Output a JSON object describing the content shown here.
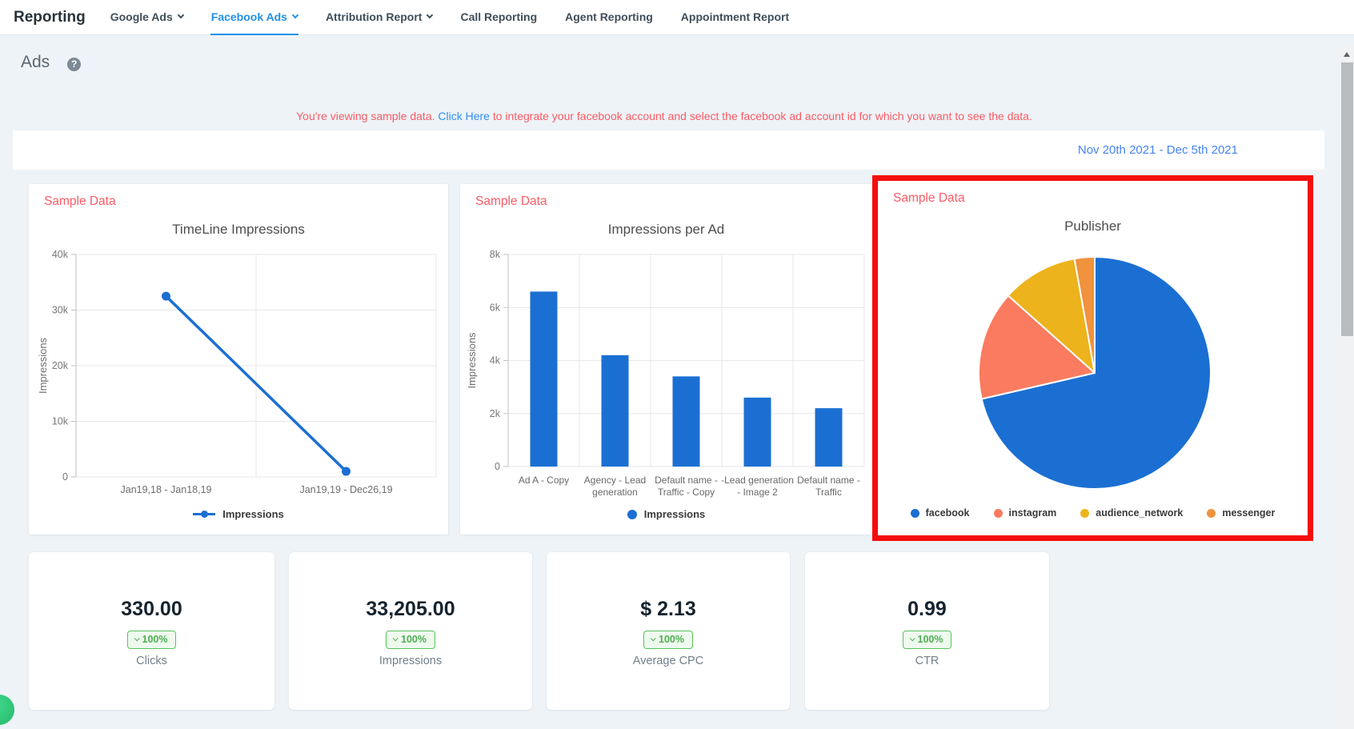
{
  "nav": {
    "brand": "Reporting",
    "items": [
      {
        "label": "Google Ads",
        "has_dropdown": true,
        "active": false
      },
      {
        "label": "Facebook Ads",
        "has_dropdown": true,
        "active": true
      },
      {
        "label": "Attribution Report",
        "has_dropdown": true,
        "active": false
      },
      {
        "label": "Call Reporting",
        "has_dropdown": false,
        "active": false
      },
      {
        "label": "Agent Reporting",
        "has_dropdown": false,
        "active": false
      },
      {
        "label": "Appointment Report",
        "has_dropdown": false,
        "active": false
      }
    ]
  },
  "page": {
    "title": "Ads",
    "help_icon": "question-mark-circle"
  },
  "banner": {
    "prefix": "You're viewing sample data.",
    "link": "Click Here",
    "suffix": "to integrate your facebook account and select the facebook ad account id for which you want to see the data."
  },
  "date_range": "Nov 20th 2021 - Dec 5th 2021",
  "sample_data_label": "Sample Data",
  "colors": {
    "accent_blue": "#2191ea",
    "alert_red": "#fb5b64",
    "link_blue": "#2f8ef4",
    "date_blue": "#4584f0",
    "chart_blue": "#1b6fd2",
    "badge_green": "#4cae4f",
    "annotation_red": "#f60d0d"
  },
  "chart_data": [
    {
      "type": "line",
      "title": "TimeLine Impressions",
      "ylabel": "Impressions",
      "x": [
        "Jan19,18 - Jan18,19",
        "Jan19,19 - Dec26,19"
      ],
      "series": [
        {
          "name": "Impressions",
          "values": [
            32500,
            1000
          ]
        }
      ],
      "ylim": [
        0,
        40000
      ],
      "yticks": [
        "0",
        "10k",
        "20k",
        "30k",
        "40k"
      ],
      "grid": true,
      "legend_position": "bottom",
      "color": "#1b6fd2"
    },
    {
      "type": "bar",
      "title": "Impressions per Ad",
      "ylabel": "Impressions",
      "categories": [
        "Ad A - Copy",
        "Agency - Lead generation",
        "Default name - Traffic - Copy",
        "-Lead generation - Image 2",
        "Default name - Traffic"
      ],
      "categories_lines": [
        [
          "Ad A - Copy"
        ],
        [
          "Agency - Lead",
          "generation"
        ],
        [
          "Default name -",
          "Traffic - Copy"
        ],
        [
          "-Lead generation",
          "- Image 2"
        ],
        [
          "Default name -",
          "Traffic"
        ]
      ],
      "values": [
        6600,
        4200,
        3400,
        2600,
        2200
      ],
      "ylim": [
        0,
        8000
      ],
      "yticks": [
        "0",
        "2k",
        "4k",
        "6k",
        "8k"
      ],
      "legend": "Impressions",
      "grid": true,
      "legend_position": "bottom",
      "color": "#1b6fd2"
    },
    {
      "type": "pie",
      "title": "Publisher",
      "slices": [
        {
          "label": "facebook",
          "pct": 71.4,
          "color": "#1b6fd2"
        },
        {
          "label": "instagram",
          "pct": 15.2,
          "color": "#fa7b5f"
        },
        {
          "label": "audience_network",
          "pct": 10.6,
          "color": "#edb31c"
        },
        {
          "label": "messenger",
          "pct": 2.8,
          "color": "#f0923e"
        }
      ],
      "legend_position": "bottom"
    }
  ],
  "stats": [
    {
      "value": "330.00",
      "change": "100%",
      "direction": "down",
      "label": "Clicks"
    },
    {
      "value": "33,205.00",
      "change": "100%",
      "direction": "down",
      "label": "Impressions"
    },
    {
      "value": "$ 2.13",
      "change": "100%",
      "direction": "down",
      "label": "Average CPC"
    },
    {
      "value": "0.99",
      "change": "100%",
      "direction": "down",
      "label": "CTR"
    }
  ]
}
